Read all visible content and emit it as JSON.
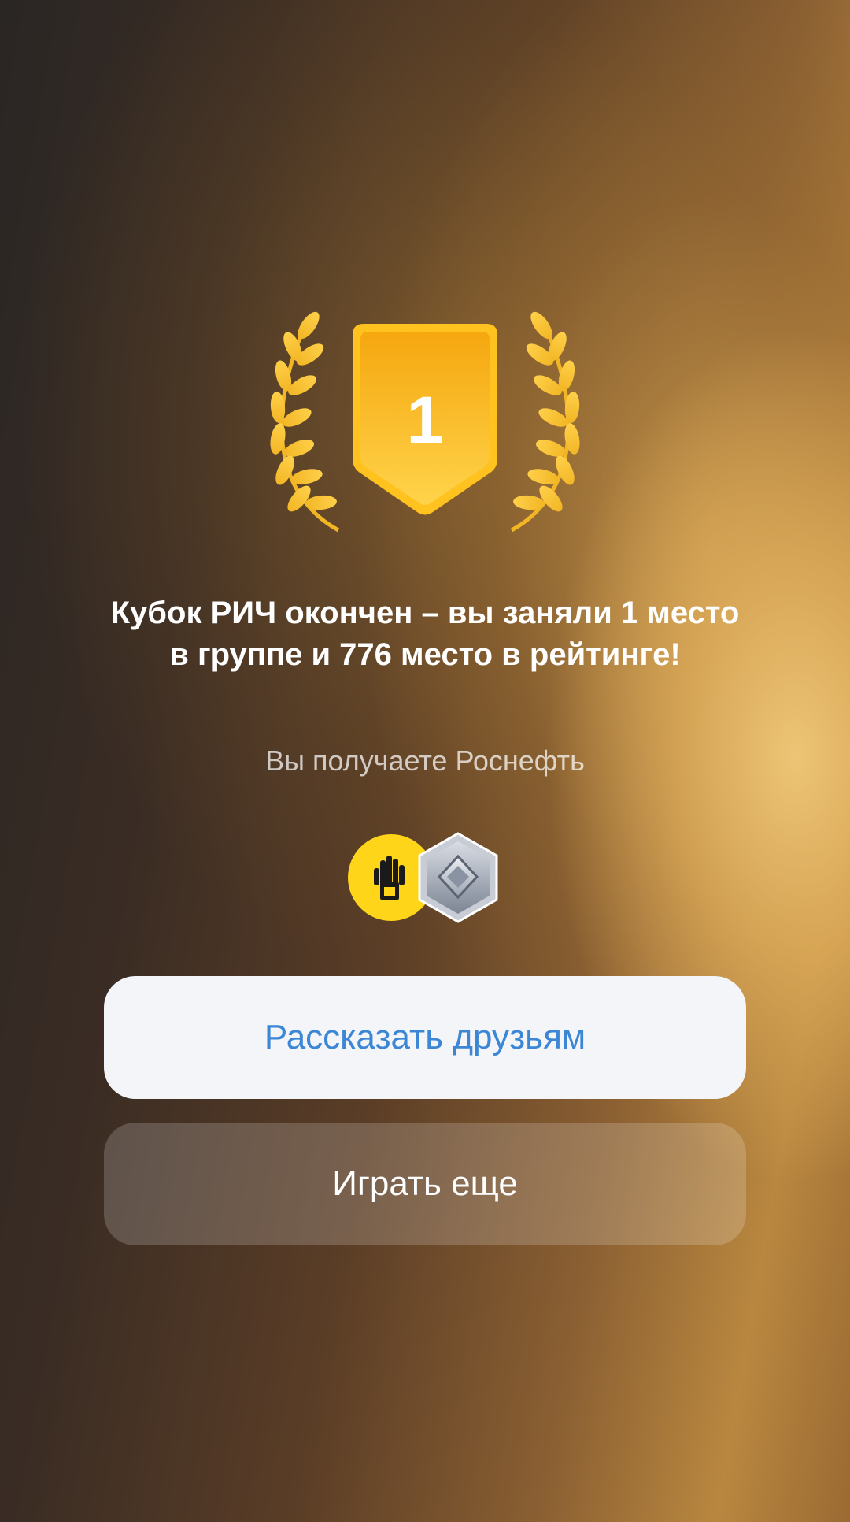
{
  "result": {
    "place_number": "1",
    "title": "Кубок РИЧ окончен – вы заняли 1 место в группе и 776 место в рейтинге!",
    "subtitle": "Вы получаете Роснефть"
  },
  "rewards": {
    "items": [
      {
        "icon": "rosneft-logo-icon",
        "color": "#ffd51a"
      },
      {
        "icon": "silver-diamond-badge-icon",
        "color": "#a9afba"
      }
    ]
  },
  "actions": {
    "share_label": "Рассказать друзьям",
    "play_again_label": "Играть еще"
  },
  "colors": {
    "trophy_gold": "#ffc21e",
    "share_text": "#3c86d6",
    "share_bg": "#f3f5f8"
  }
}
